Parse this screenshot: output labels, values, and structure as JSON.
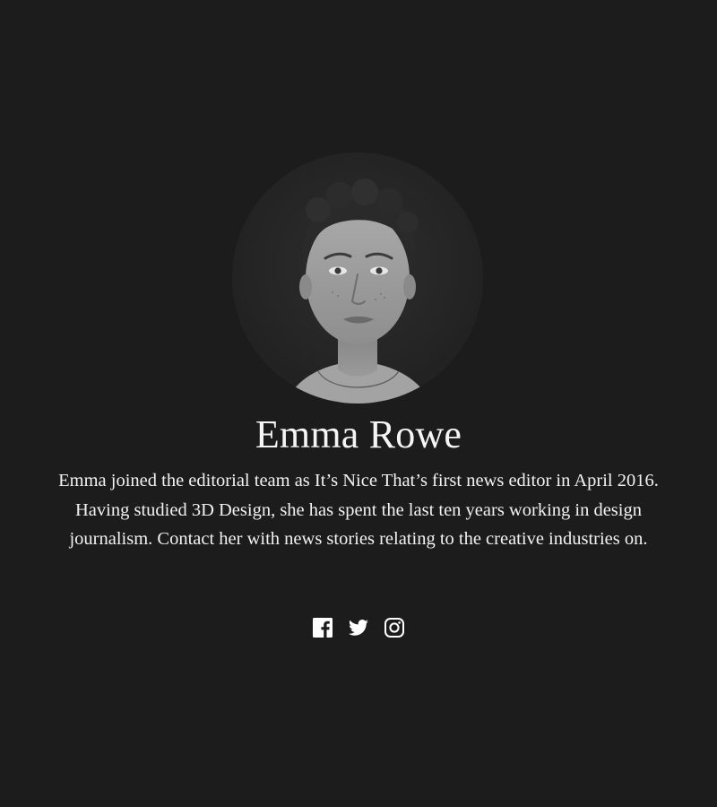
{
  "profile": {
    "name": "Emma Rowe",
    "bio": "Emma joined the editorial team as It’s Nice That’s first news editor in April 2016. Having studied 3D Design, she has spent the last ten years working in design journalism. Contact her with news stories relating to the creative industries on."
  },
  "social": {
    "links": [
      {
        "icon": "facebook-icon"
      },
      {
        "icon": "twitter-icon"
      },
      {
        "icon": "instagram-icon"
      }
    ]
  },
  "colors": {
    "background": "#1c1c1c",
    "text": "#ffffff"
  }
}
